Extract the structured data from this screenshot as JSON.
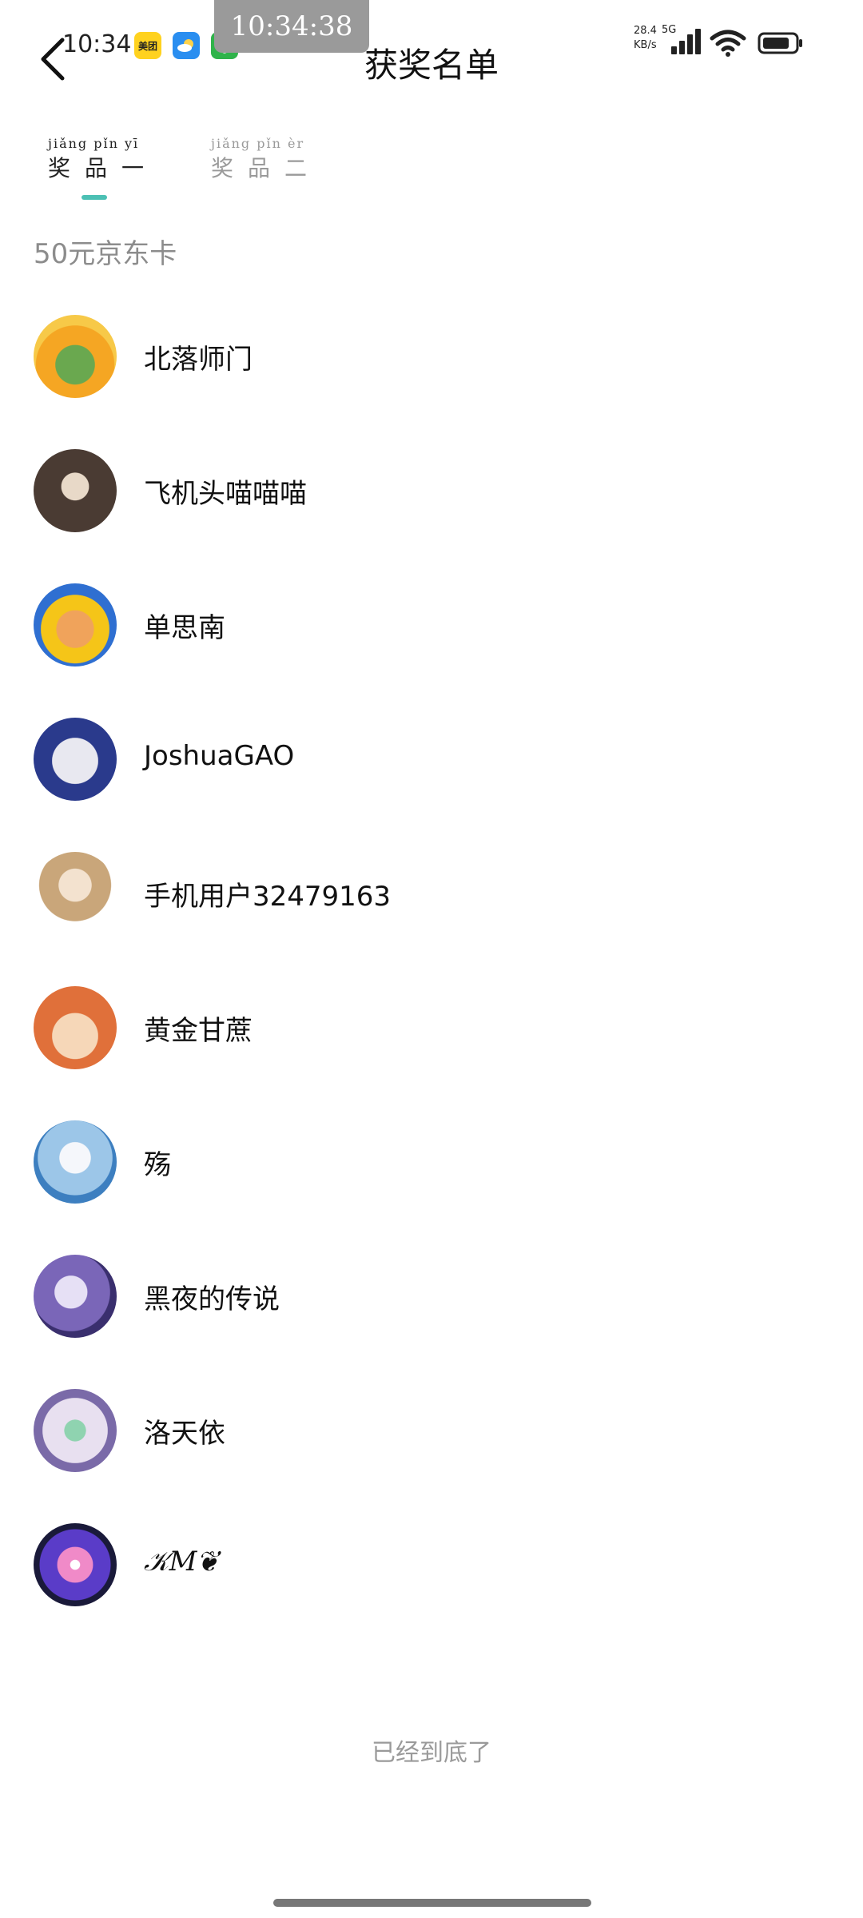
{
  "status_bar": {
    "time": "10:34",
    "timer": "10:34:38",
    "net_speed_value": "28.4",
    "net_speed_unit": "KB/s",
    "network_type": "5G",
    "notification_icons": [
      "meituan-icon",
      "weather-icon",
      "security-icon"
    ],
    "meituan_label": "美团"
  },
  "header": {
    "title": "获奖名单",
    "back_icon": "chevron-left-icon"
  },
  "tabs": [
    {
      "label": "奖品一",
      "pinyin": "jiǎng pǐn yī",
      "active": true
    },
    {
      "label": "奖品二",
      "pinyin": "jiǎng pǐn èr",
      "active": false
    }
  ],
  "accent_color": "#4cc0b4",
  "prize": {
    "title": "50元京东卡"
  },
  "winners": [
    {
      "name": "北落师门"
    },
    {
      "name": "飞机头喵喵喵"
    },
    {
      "name": "单思南"
    },
    {
      "name": "JoshuaGAO"
    },
    {
      "name": "手机用户32479163"
    },
    {
      "name": "黄金甘蔗"
    },
    {
      "name": "殇"
    },
    {
      "name": "黑夜的传说"
    },
    {
      "name": "洛天依"
    },
    {
      "name": "𝒦𝑀❦"
    }
  ],
  "footer": {
    "end_text": "已经到底了"
  }
}
